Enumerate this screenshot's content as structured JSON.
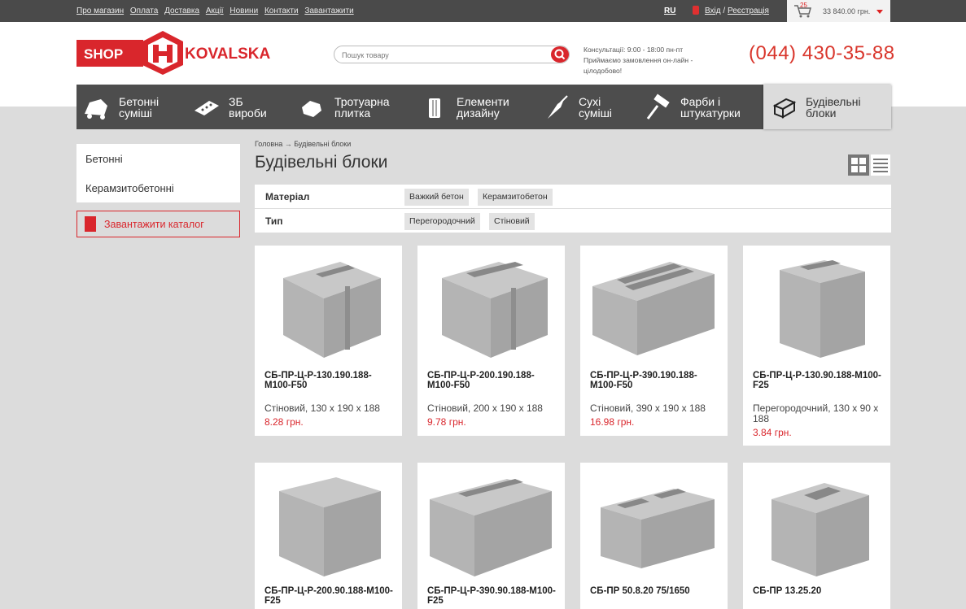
{
  "topbar": {
    "links": [
      "Про магазин",
      "Оплата",
      "Доставка",
      "Акції",
      "Новини",
      "Контакти",
      "Завантажити"
    ],
    "lang": "RU",
    "login": "Вхід",
    "sep": "/",
    "register": "Реєстрація",
    "cart_count": "25",
    "cart_total": "33 840.00 грн."
  },
  "header": {
    "logo_left": "SHOP",
    "logo_right": "KOVALSKA",
    "search_placeholder": "Пошук товару",
    "consult_1": "Консультації: 9:00 - 18:00 пн-пт",
    "consult_2": "Приймаємо замовлення он-лайн -",
    "consult_3": "цілодобово!",
    "phone": "(044) 430-35-88"
  },
  "categories": [
    {
      "l1": "Бетонні",
      "l2": "суміші",
      "icon": "concrete-mixer-icon"
    },
    {
      "l1": "ЗБ",
      "l2": "вироби",
      "icon": "slab-icon"
    },
    {
      "l1": "Тротуарна",
      "l2": "плитка",
      "icon": "paving-icon"
    },
    {
      "l1": "Елементи",
      "l2": "дизайну",
      "icon": "column-icon"
    },
    {
      "l1": "Сухі",
      "l2": "суміші",
      "icon": "trowel-icon"
    },
    {
      "l1": "Фарби і",
      "l2": "штукатурки",
      "icon": "paint-roller-icon"
    },
    {
      "l1": "Будівельні",
      "l2": "блоки",
      "icon": "block-icon"
    }
  ],
  "sidebar": {
    "items": [
      "Бетонні",
      "Керамзитобетонні"
    ],
    "download": "Завантажити каталог"
  },
  "breadcrumb": "Головна → Будівельні блоки",
  "page_title": "Будівельні блоки",
  "filters": {
    "material_label": "Матеріал",
    "material_options": [
      "Важкий бетон",
      "Керамзитобетон"
    ],
    "type_label": "Тип",
    "type_options": [
      "Перегородочний",
      "Стіновий"
    ]
  },
  "products": [
    {
      "name": "СБ-ПР-Ц-Р-130.190.188-М100-F50",
      "desc": "Стіновий, 130 x 190 x 188",
      "price": "8.28 грн."
    },
    {
      "name": "СБ-ПР-Ц-Р-200.190.188-М100-F50",
      "desc": "Стіновий, 200 x 190 x 188",
      "price": "9.78 грн."
    },
    {
      "name": "СБ-ПР-Ц-Р-390.190.188-М100-F50",
      "desc": "Стіновий, 390 x 190 x 188",
      "price": "16.98 грн."
    },
    {
      "name": "СБ-ПР-Ц-Р-130.90.188-М100-F25",
      "desc": "Перегородочний, 130 x 90 x 188",
      "price": "3.84 грн."
    },
    {
      "name": "СБ-ПР-Ц-Р-200.90.188-М100-F25",
      "desc": "",
      "price": ""
    },
    {
      "name": "СБ-ПР-Ц-Р-390.90.188-М100-F25",
      "desc": "",
      "price": ""
    },
    {
      "name": "СБ-ПР 50.8.20 75/1650",
      "desc": "",
      "price": ""
    },
    {
      "name": "СБ-ПР 13.25.20",
      "desc": "",
      "price": ""
    }
  ],
  "colors": {
    "accent": "#d9262c",
    "nav": "#4d4d4d",
    "topbar": "#4a4a4a"
  }
}
